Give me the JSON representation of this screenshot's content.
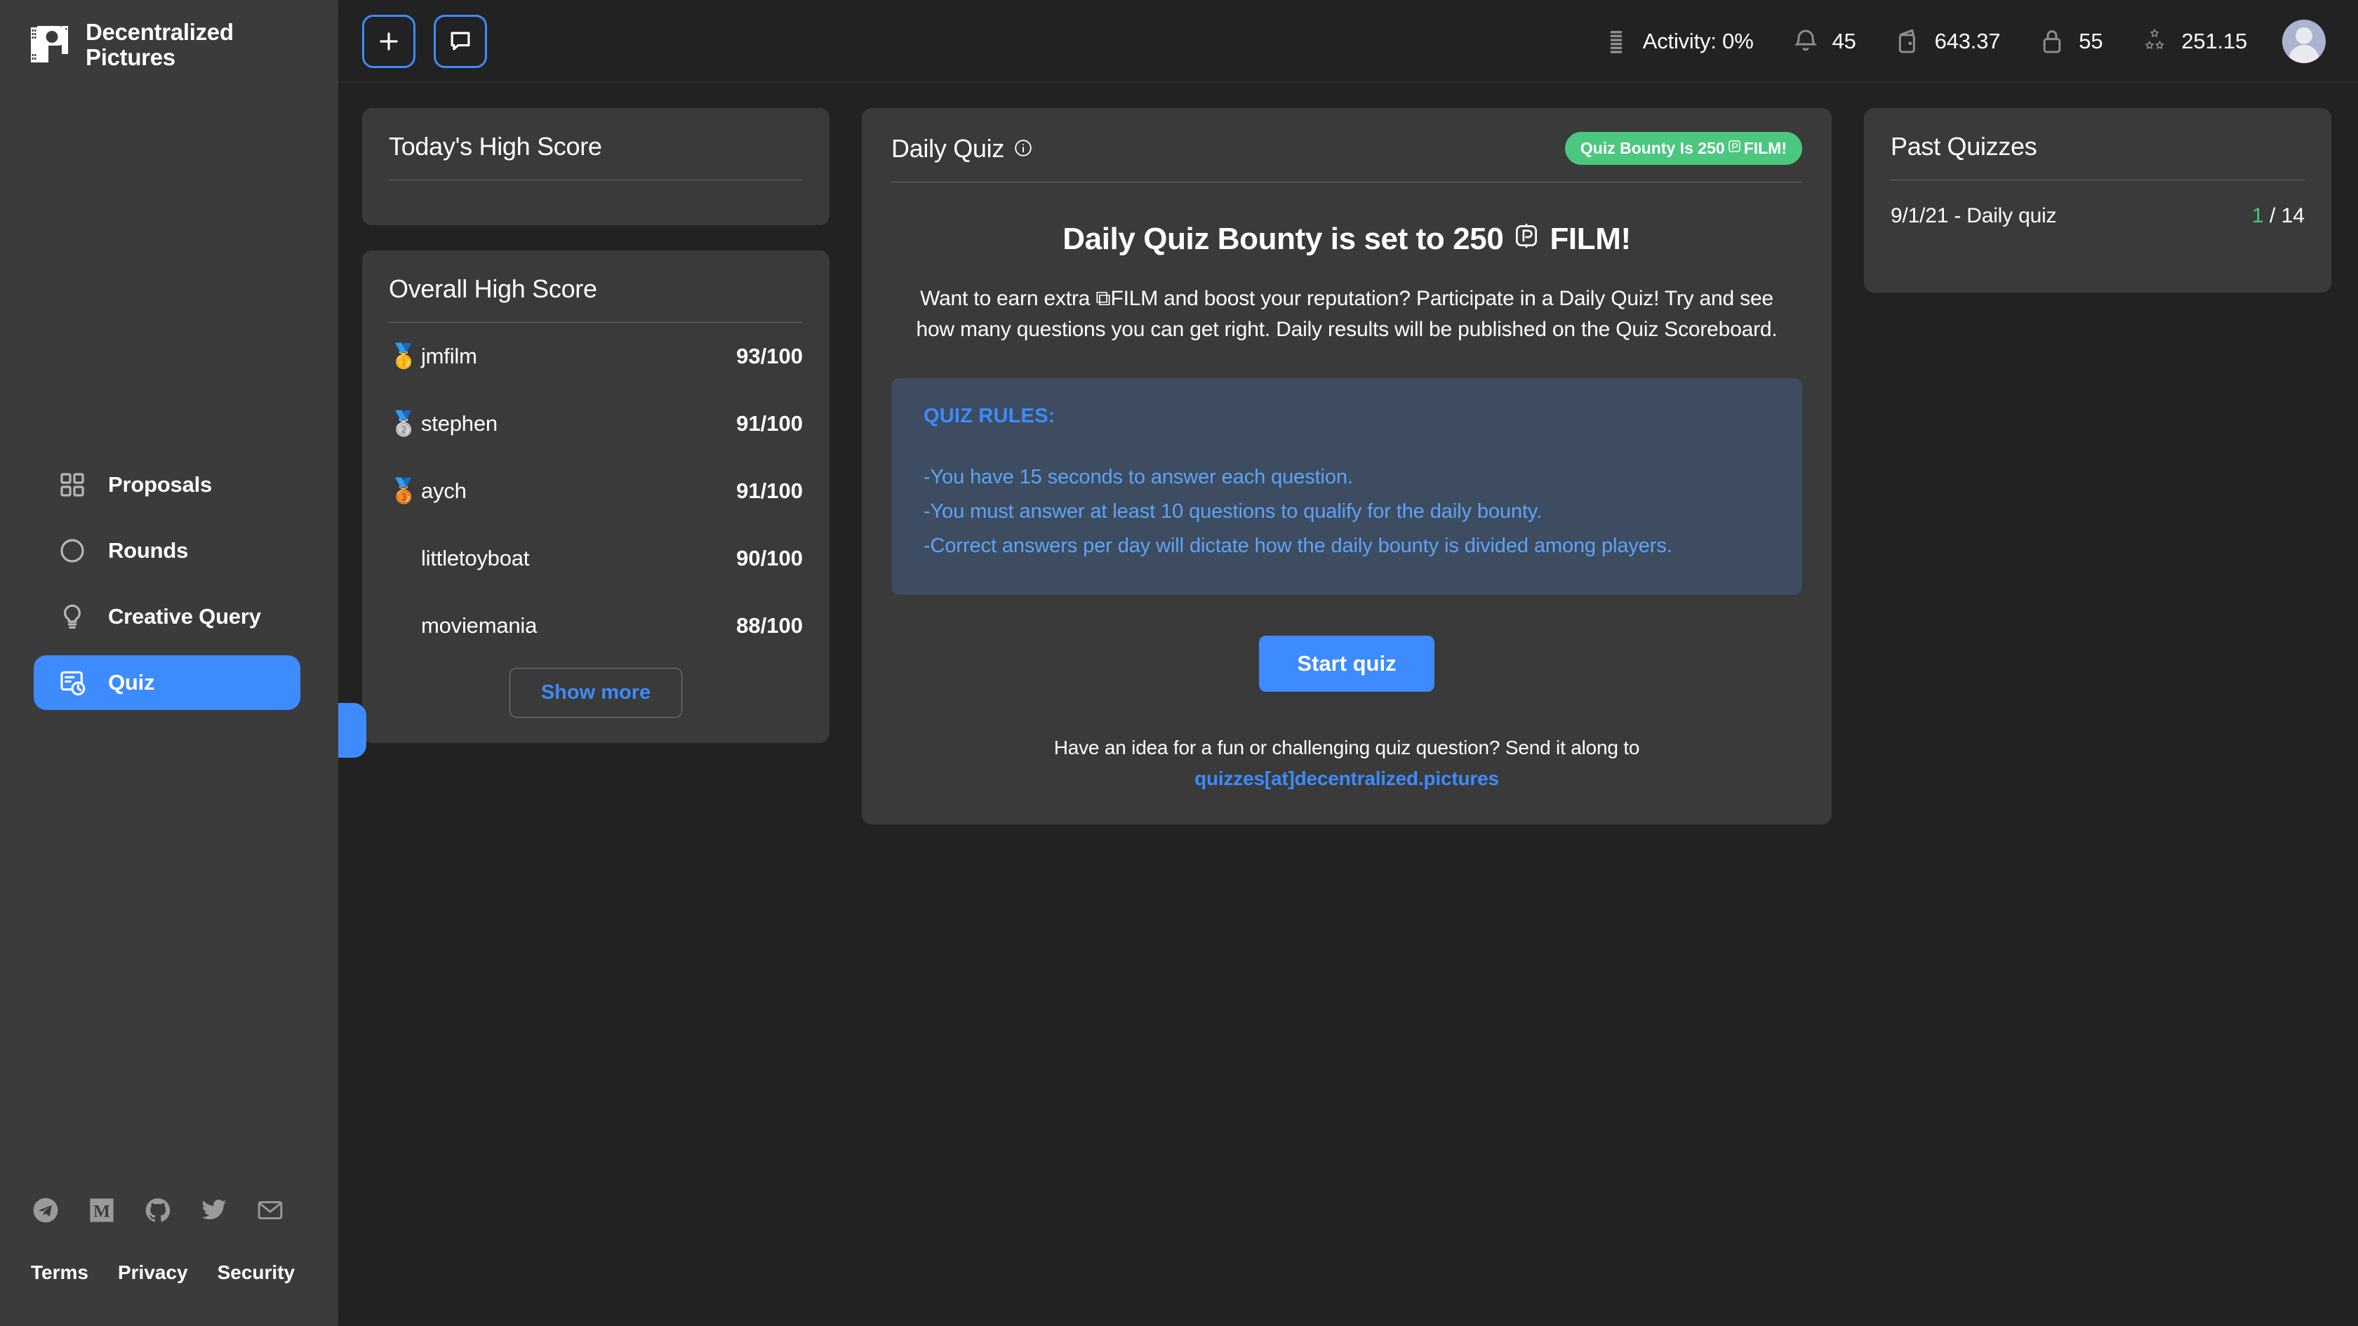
{
  "brand": {
    "line1": "Decentralized",
    "line2": "Pictures"
  },
  "topbar": {
    "add_button": "add-button",
    "chat_button": "chat-button",
    "stats": [
      {
        "icon": "activity-icon",
        "label": "Activity: 0%"
      },
      {
        "icon": "bell-icon",
        "label": "45"
      },
      {
        "icon": "wallet-icon",
        "label": "643.37"
      },
      {
        "icon": "lock-icon",
        "label": "55"
      },
      {
        "icon": "reputation-stars-icon",
        "label": "251.15"
      }
    ]
  },
  "sidebar": {
    "items": [
      {
        "label": "Proposals",
        "icon": "grid-icon",
        "active": false
      },
      {
        "label": "Rounds",
        "icon": "circle-icon",
        "active": false
      },
      {
        "label": "Creative Query",
        "icon": "lightbulb-icon",
        "active": false
      },
      {
        "label": "Quiz",
        "icon": "quiz-clock-icon",
        "active": true
      }
    ],
    "social": [
      "telegram-icon",
      "medium-icon",
      "github-icon",
      "twitter-icon",
      "email-icon"
    ],
    "legal": [
      "Terms",
      "Privacy",
      "Security"
    ]
  },
  "today_high_score": {
    "title": "Today's High Score"
  },
  "overall_high_score": {
    "title": "Overall High Score",
    "rows": [
      {
        "medal": "🥇",
        "name": "jmfilm",
        "score": "93/100"
      },
      {
        "medal": "🥈",
        "name": "stephen",
        "score": "91/100"
      },
      {
        "medal": "🥉",
        "name": "aych",
        "score": "91/100"
      },
      {
        "medal": "",
        "name": "littletoyboat",
        "score": "90/100"
      },
      {
        "medal": "",
        "name": "moviemania",
        "score": "88/100"
      }
    ],
    "show_more": "Show more"
  },
  "daily_quiz": {
    "title": "Daily Quiz",
    "info_icon": "info-icon",
    "bounty_badge_pre": "Quiz Bounty Is 250",
    "bounty_badge_post": "FILM!",
    "heading_pre": "Daily Quiz Bounty is set to 250",
    "heading_post": "FILM!",
    "description": "Want to earn extra ⧉FILM and boost your reputation? Participate in a Daily Quiz! Try and see how many questions you can get right. Daily results will be published on the Quiz Scoreboard.",
    "rules_title": "QUIZ RULES:",
    "rules": [
      "-You have 15 seconds to answer each question.",
      "-You must answer at least 10 questions to qualify for the daily bounty.",
      "-Correct answers per day will dictate how the daily bounty is divided among players."
    ],
    "start_button": "Start quiz",
    "contact_text": "Have an idea for a fun or challenging quiz question? Send it along to",
    "contact_email": "quizzes[at]decentralized.pictures"
  },
  "past_quizzes": {
    "title": "Past Quizzes",
    "rows": [
      {
        "label": "9/1/21 - Daily quiz",
        "correct": "1",
        "total": "/ 14"
      }
    ]
  },
  "colors": {
    "accent": "#3d8bfd",
    "success": "#4CC780",
    "sidebar_bg": "#3b3b3b",
    "main_bg": "#222222",
    "card_bg": "#3a3a3a",
    "rules_bg": "#3d4c60"
  }
}
